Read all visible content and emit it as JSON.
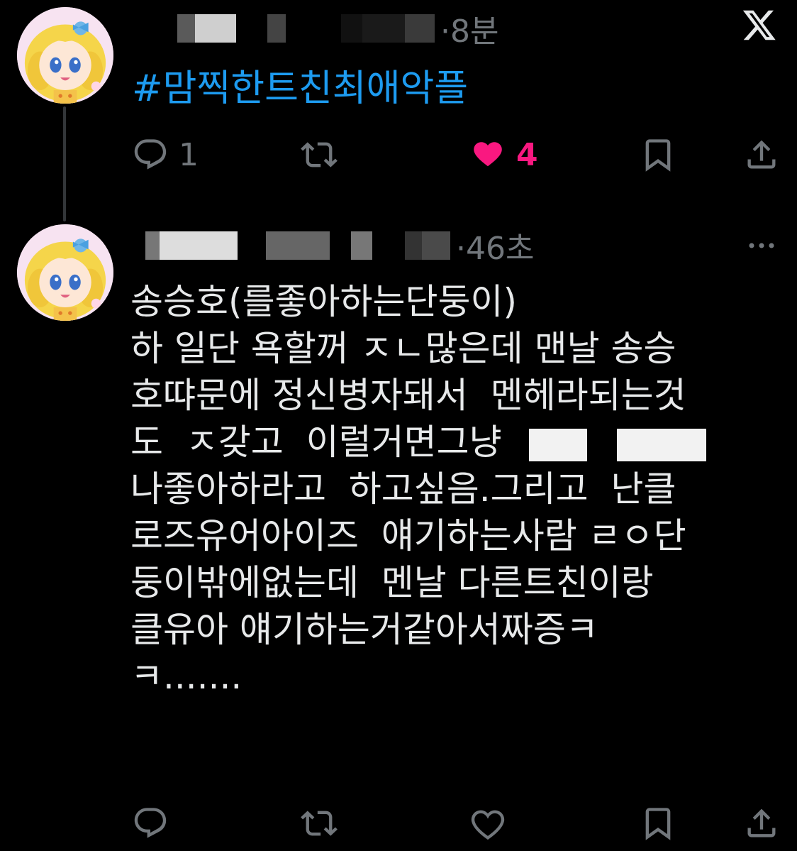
{
  "posts": [
    {
      "author_redacted": true,
      "time": "·8분",
      "hashtag": "#맘찍한트친최애악플",
      "actions": {
        "reply_count": "1",
        "repost_count": "",
        "like_count": "4",
        "liked": true
      }
    },
    {
      "author_redacted": true,
      "time": "·46초",
      "lines": [
        "송승호(를좋아하는단둥이)",
        "하 일단 욕할꺼 ㅈㄴ많은데 맨날 송승",
        "호땨문에 정신병자돼서  멘헤라되는것",
        "도  ㅈ갖고  이럴거면그냥",
        "나좋아하라고  하고싶음.그리고  난클",
        "로즈유어아이즈  얘기하는사람 ㄹㅇ단",
        "둥이밖에없는데  멘날 다른트친이랑",
        "클유아 얘기하는거같아서짜증ㅋ",
        "ㅋ......."
      ],
      "actions": {
        "reply_count": "",
        "repost_count": "",
        "like_count": "",
        "liked": false
      }
    }
  ],
  "icons": {
    "logo": "x-logo-icon",
    "more": "more-icon",
    "reply": "reply-icon",
    "repost": "repost-icon",
    "like": "heart-icon",
    "bookmark": "bookmark-icon",
    "share": "share-icon"
  },
  "colors": {
    "background": "#000000",
    "text": "#e7e9ea",
    "muted": "#71767b",
    "link": "#1d9bf0",
    "like": "#f91880"
  }
}
